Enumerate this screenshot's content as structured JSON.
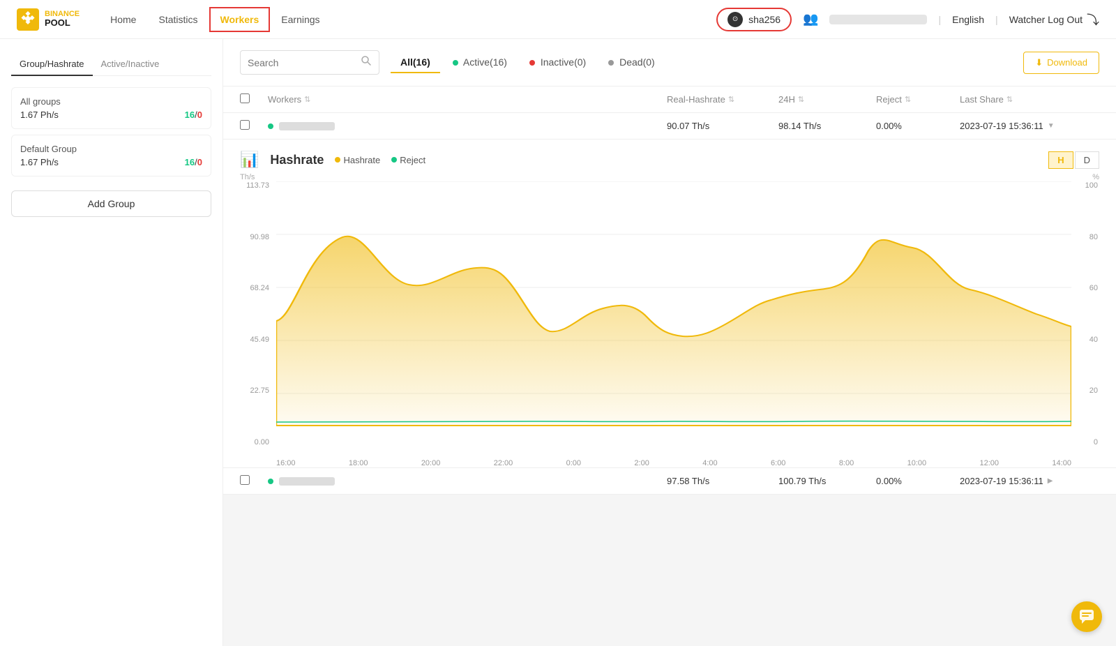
{
  "logo": {
    "name": "BINANCE",
    "sub": "POOL"
  },
  "nav": {
    "items": [
      {
        "id": "home",
        "label": "Home",
        "active": false
      },
      {
        "id": "statistics",
        "label": "Statistics",
        "active": false
      },
      {
        "id": "workers",
        "label": "Workers",
        "active": true
      },
      {
        "id": "earnings",
        "label": "Earnings",
        "active": false
      }
    ]
  },
  "header": {
    "sha_label": "sha256",
    "language": "English",
    "watcher_logout": "Watcher Log Out"
  },
  "sidebar": {
    "tab1": "Group/Hashrate",
    "tab2": "Active/Inactive",
    "groups": [
      {
        "name": "All groups",
        "hashrate": "1.67 Ph/s",
        "active": "16",
        "inactive": "0"
      },
      {
        "name": "Default Group",
        "hashrate": "1.67 Ph/s",
        "active": "16",
        "inactive": "0"
      }
    ],
    "add_group": "Add Group"
  },
  "toolbar": {
    "search_placeholder": "Search",
    "download_label": "Download",
    "filters": [
      {
        "id": "all",
        "label": "All(16)",
        "active": true,
        "dot": null
      },
      {
        "id": "active",
        "label": "Active(16)",
        "active": false,
        "dot": "green"
      },
      {
        "id": "inactive",
        "label": "Inactive(0)",
        "active": false,
        "dot": "red"
      },
      {
        "id": "dead",
        "label": "Dead(0)",
        "active": false,
        "dot": "gray"
      }
    ]
  },
  "table": {
    "columns": [
      "Workers",
      "Real-Hashrate",
      "24H",
      "Reject",
      "Last Share"
    ],
    "rows": [
      {
        "worker": "",
        "real_hashrate": "90.07 Th/s",
        "h24": "98.14 Th/s",
        "reject": "0.00%",
        "last_share": "2023-07-19 15:36:11",
        "status": "active",
        "expanded": true
      },
      {
        "worker": "",
        "real_hashrate": "97.58 Th/s",
        "h24": "100.79 Th/s",
        "reject": "0.00%",
        "last_share": "2023-07-19 15:36:11",
        "status": "active",
        "expanded": false
      }
    ]
  },
  "chart": {
    "title": "Hashrate",
    "legend_hashrate": "Hashrate",
    "legend_reject": "Reject",
    "unit_left": "Th/s",
    "unit_right": "%",
    "btn_h": "H",
    "btn_d": "D",
    "y_labels_left": [
      "113.73",
      "90.98",
      "68.24",
      "45.49",
      "22.75",
      "0.00"
    ],
    "y_labels_right": [
      "100",
      "80",
      "60",
      "40",
      "20",
      "0"
    ],
    "x_labels": [
      "16:00",
      "18:00",
      "20:00",
      "22:00",
      "0:00",
      "2:00",
      "4:00",
      "6:00",
      "8:00",
      "10:00",
      "12:00",
      "14:00"
    ]
  },
  "colors": {
    "yellow": "#f0b90b",
    "green": "#16c784",
    "red": "#e53935",
    "active_border": "#e53935"
  }
}
